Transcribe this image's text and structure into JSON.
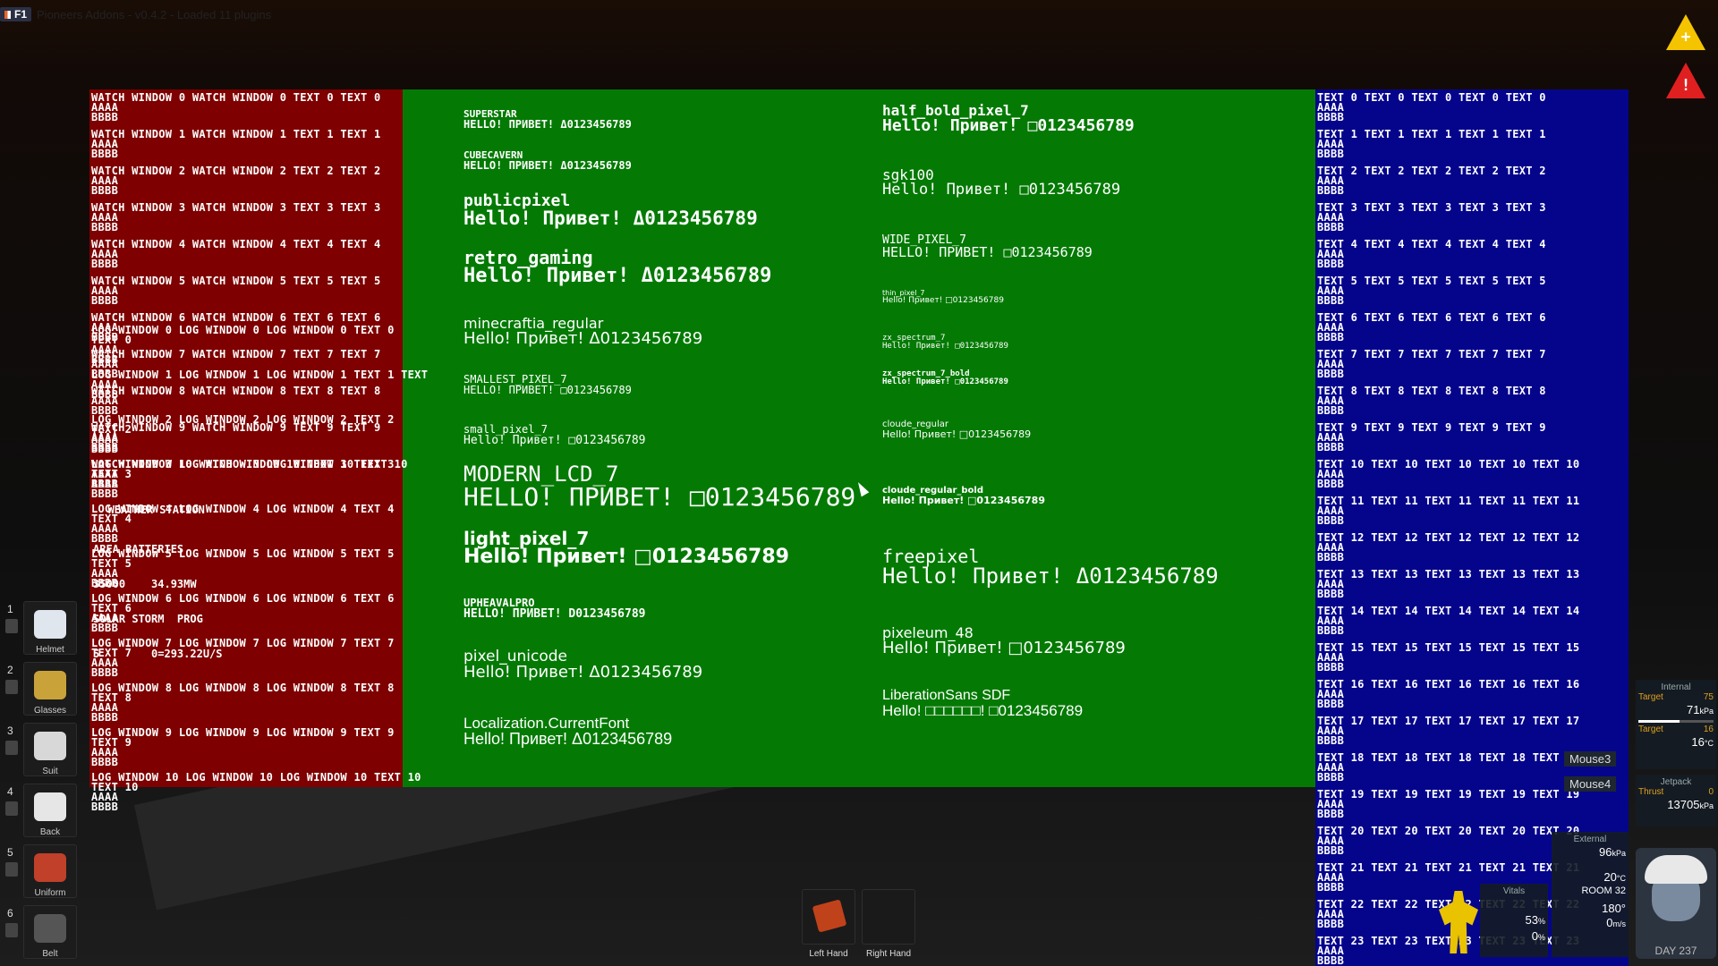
{
  "topbar": {
    "badge": "F1",
    "title": "Pioneers Addons - v0.4.2 - Loaded 11 plugins"
  },
  "watch_lines": [
    "WATCH WINDOW 0 WATCH WINDOW 0 TEXT 0 TEXT 0",
    "WATCH WINDOW 1 WATCH WINDOW 1 TEXT 1 TEXT 1",
    "WATCH WINDOW 2 WATCH WINDOW 2 TEXT 2 TEXT 2",
    "WATCH WINDOW 3 WATCH WINDOW 3 TEXT 3 TEXT 3",
    "WATCH WINDOW 4 WATCH WINDOW 4 TEXT 4 TEXT 4",
    "WATCH WINDOW 5 WATCH WINDOW 5 TEXT 5 TEXT 5",
    "WATCH WINDOW 6 WATCH WINDOW 6 TEXT 6 TEXT 6",
    "WATCH WINDOW 7 WATCH WINDOW 7 TEXT 7 TEXT 7",
    "WATCH WINDOW 8 WATCH WINDOW 8 TEXT 8 TEXT 8",
    "WATCH WINDOW 9 WATCH WINDOW 9 TEXT 9 TEXT 9",
    "WATCH WINDOW 10 WATCH WINDOW 10 TEXT 10 TEXT 10"
  ],
  "log_lines": [
    "LOG WINDOW 0 LOG WINDOW 0 LOG WINDOW 0 TEXT 0\nTEXT 0",
    "LOG WINDOW 1 LOG WINDOW 1 LOG WINDOW 1 TEXT 1 TEXT",
    "LOG WINDOW 2 LOG WINDOW 2 LOG WINDOW 2 TEXT 2\nTEXT 2",
    "LOG WINDOW 3 LOG WINDOW 3 LOG WINDOW 3 TEXT 3\nTEXT 3",
    "LOG WINDOW 4 LOG WINDOW 4 LOG WINDOW 4 TEXT 4\nTEXT 4",
    "LOG WINDOW 5 LOG WINDOW 5 LOG WINDOW 5 TEXT 5\nTEXT 5",
    "LOG WINDOW 6 LOG WINDOW 6 LOG WINDOW 6 TEXT 6\nTEXT 6",
    "LOG WINDOW 7 LOG WINDOW 7 LOG WINDOW 7 TEXT 7\nTEXT 7",
    "LOG WINDOW 8 LOG WINDOW 8 LOG WINDOW 8 TEXT 8\nTEXT 8",
    "LOG WINDOW 9 LOG WINDOW 9 LOG WINDOW 9 TEXT 9\nTEXT 9",
    "LOG WINDOW 10 LOG WINDOW 10 LOG WINDOW 10 TEXT 10\nTEXT 10"
  ],
  "text_lines": [
    "TEXT 0 TEXT 0 TEXT 0 TEXT 0 TEXT 0",
    "TEXT 1 TEXT 1 TEXT 1 TEXT 1 TEXT 1",
    "TEXT 2 TEXT 2 TEXT 2 TEXT 2 TEXT 2",
    "TEXT 3 TEXT 3 TEXT 3 TEXT 3 TEXT 3",
    "TEXT 4 TEXT 4 TEXT 4 TEXT 4 TEXT 4",
    "TEXT 5 TEXT 5 TEXT 5 TEXT 5 TEXT 5",
    "TEXT 6 TEXT 6 TEXT 6 TEXT 6 TEXT 6",
    "TEXT 7 TEXT 7 TEXT 7 TEXT 7 TEXT 7",
    "TEXT 8 TEXT 8 TEXT 8 TEXT 8 TEXT 8",
    "TEXT 9 TEXT 9 TEXT 9 TEXT 9 TEXT 9",
    "TEXT 10 TEXT 10 TEXT 10 TEXT 10 TEXT 10",
    "TEXT 11 TEXT 11 TEXT 11 TEXT 11 TEXT 11",
    "TEXT 12 TEXT 12 TEXT 12 TEXT 12 TEXT 12",
    "TEXT 13 TEXT 13 TEXT 13 TEXT 13 TEXT 13",
    "TEXT 14 TEXT 14 TEXT 14 TEXT 14 TEXT 14",
    "TEXT 15 TEXT 15 TEXT 15 TEXT 15 TEXT 15",
    "TEXT 16 TEXT 16 TEXT 16 TEXT 16 TEXT 16",
    "TEXT 17 TEXT 17 TEXT 17 TEXT 17 TEXT 17",
    "TEXT 18 TEXT 18 TEXT 18 TEXT 18 TEXT 18",
    "TEXT 19 TEXT 19 TEXT 19 TEXT 19 TEXT 19",
    "TEXT 20 TEXT 20 TEXT 20 TEXT 20 TEXT 20",
    "TEXT 21 TEXT 21 TEXT 21 TEXT 21 TEXT 21",
    "TEXT 22 TEXT 22 TEXT 22 TEXT 22 TEXT 22",
    "TEXT 23 TEXT 23 TEXT 23 TEXT 23 TEXT 23"
  ],
  "filler_a": "AAAA",
  "filler_b": "BBBB",
  "weather": {
    "title": "WEATHER STATION",
    "batt": "AREA BATTERIES",
    "line1": "35000    34.93MW",
    "line2": "SOLAR STORM  PROG",
    "line3": "5        0=293.22U/S"
  },
  "fonts": [
    {
      "name": "SUPERSTAR",
      "text": "HELLO! ПРИВЕТ! Δ0123456789"
    },
    {
      "name": "CUBECAVERN",
      "text": "HELLO! ПРИВЕТ! Δ0123456789"
    },
    {
      "name": "publicpixel",
      "text": "Hello! Привет! Δ0123456789"
    },
    {
      "name": "retro_gaming",
      "text": "Hello! Привет! Δ0123456789"
    },
    {
      "name": "minecraftia_regular",
      "text": "Hello! Привет! Δ0123456789"
    },
    {
      "name": "SMALLEST_PIXEL_7",
      "text": "HELLO! ПРИВЕТ! □0123456789"
    },
    {
      "name": "small_pixel_7",
      "text": "Hello! Привет! □0123456789"
    },
    {
      "name": "MODERN_LCD_7",
      "text": "HELLO! ПРИВЕТ! □0123456789"
    },
    {
      "name": "light_pixel_7",
      "text": "Hello! Привет! □0123456789"
    },
    {
      "name": "UPHEAVALPRO",
      "text": "HELLO! ПРИВЕТ! D0123456789"
    },
    {
      "name": "pixel_unicode",
      "text": "Hello! Привет! Δ0123456789"
    },
    {
      "name": "Localization.CurrentFont",
      "text": "Hello! Привет! Δ0123456789"
    },
    {
      "name": "half_bold_pixel_7",
      "text": "Hello! Привет! □0123456789"
    },
    {
      "name": "sgk100",
      "text": "Hello! Привет! □0123456789"
    },
    {
      "name": "WIDE_PIXEL_7",
      "text": "HELLO! ПРИВЕТ! □0123456789"
    },
    {
      "name": "thin_pixel_7",
      "text": "Hello! Привет! □0123456789"
    },
    {
      "name": "zx_spectrum_7",
      "text": "Hello! Привет! □0123456789"
    },
    {
      "name": "zx_spectrum_7_bold",
      "text": "Hello! Привет! □0123456789"
    },
    {
      "name": "cloude_regular",
      "text": "Hello! Привет! □0123456789"
    },
    {
      "name": "cloude_regular_bold",
      "text": "Hello! Привет! □0123456789"
    },
    {
      "name": "freepixel",
      "text": "Hello! Привет! Δ0123456789"
    },
    {
      "name": "pixeleum_48",
      "text": "Hello! Привет! □0123456789"
    },
    {
      "name": "LiberationSans SDF",
      "text": "Hello! □□□□□□! □0123456789"
    }
  ],
  "hotbar": [
    {
      "num": "1",
      "label": "Helmet"
    },
    {
      "num": "2",
      "label": "Glasses"
    },
    {
      "num": "3",
      "label": "Suit"
    },
    {
      "num": "4",
      "label": "Back"
    },
    {
      "num": "5",
      "label": "Uniform"
    },
    {
      "num": "6",
      "label": "Belt"
    }
  ],
  "hands": {
    "left": "Left Hand",
    "right": "Right Hand"
  },
  "mouse": {
    "m3": "Mouse3",
    "m4": "Mouse4"
  },
  "internal": {
    "title": "Internal",
    "target1": "Target",
    "target1_val": "75",
    "pressure": "71",
    "pressure_unit": "kPa",
    "target2": "Target",
    "target2_val": "16",
    "temp": "16",
    "temp_unit": "°C"
  },
  "jetpack": {
    "title": "Jetpack",
    "thrust": "Thrust",
    "thrust_val": "0",
    "pressure": "13705",
    "unit": "kPa"
  },
  "external": {
    "title": "External",
    "pressure": "96",
    "pressure_unit": "kPa",
    "temp": "20",
    "temp_unit": "°C",
    "room": "ROOM 32",
    "heading": "180°",
    "speed": "0",
    "speed_unit": "m/s"
  },
  "vitals": {
    "title": "Vitals",
    "health": "53",
    "health_unit": "%",
    "stamina": "0",
    "stamina_unit": "%"
  },
  "avatar": {
    "day": "DAY 237"
  },
  "colors": {
    "red": "#7e0000",
    "green": "#047a04",
    "blue": "#05058c",
    "alert_yellow": "#f5c400",
    "alert_red": "#e02020"
  }
}
